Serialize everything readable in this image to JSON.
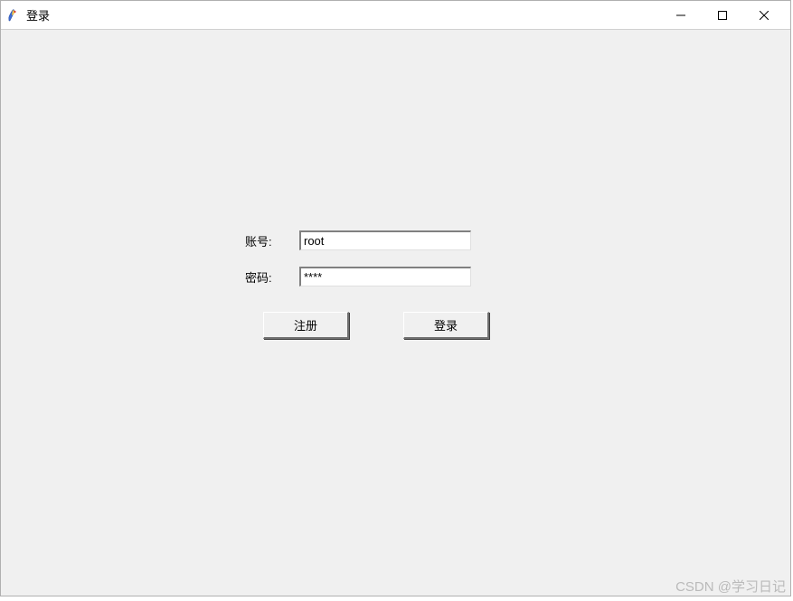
{
  "window": {
    "title": "登录"
  },
  "form": {
    "account_label": "账号:",
    "account_value": "root",
    "password_label": "密码:",
    "password_value": "****"
  },
  "buttons": {
    "register": "注册",
    "login": "登录"
  },
  "watermark": "CSDN @学习日记"
}
